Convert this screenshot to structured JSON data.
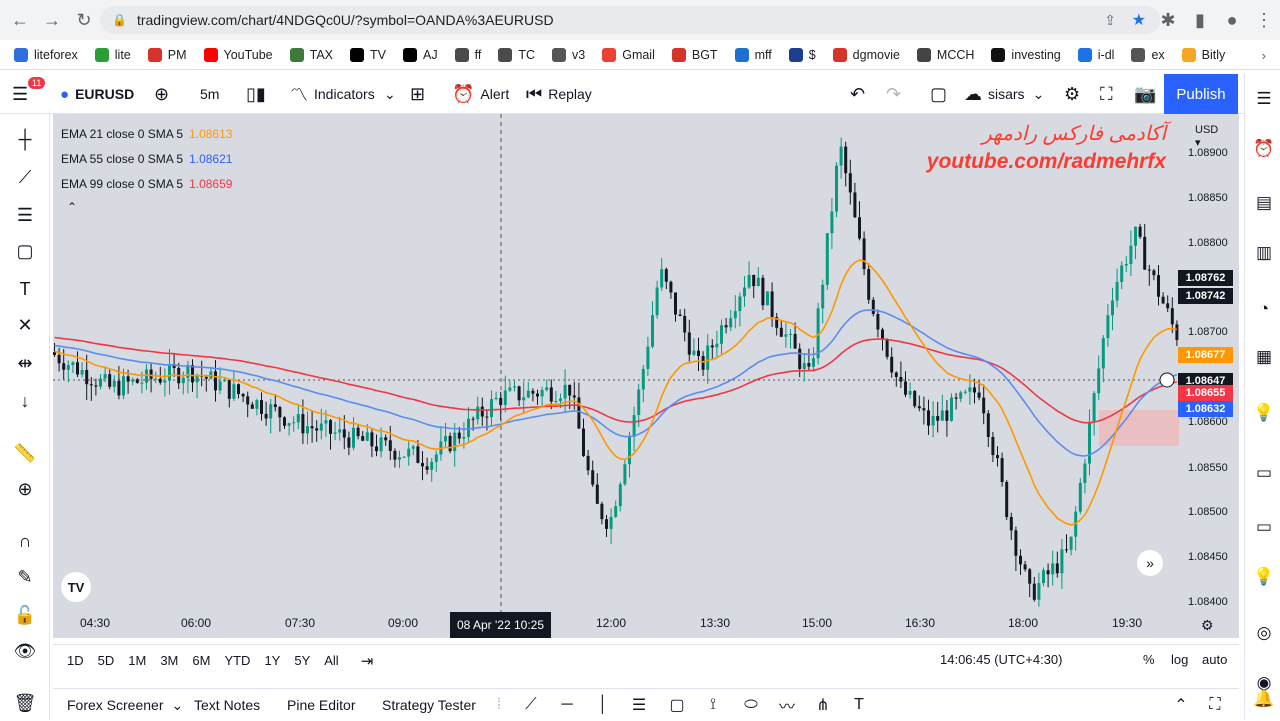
{
  "browser": {
    "url": "tradingview.com/chart/4NDGQc0U/?symbol=OANDA%3AEURUSD",
    "bookmarks": [
      "liteforex",
      "lite",
      "PM",
      "YouTube",
      "TAX",
      "TV",
      "AJ",
      "ff",
      "TC",
      "v3",
      "Gmail",
      "BGT",
      "mff",
      "$",
      "dgmovie",
      "MCCH",
      "investing",
      "i-dl",
      "ex",
      "Bitly"
    ]
  },
  "toolbar": {
    "menu_badge": "11",
    "symbol": "EURUSD",
    "interval": "5m",
    "indicators_label": "Indicators",
    "alert_label": "Alert",
    "replay_label": "Replay",
    "layout_name": "sisars",
    "publish_label": "Publish"
  },
  "legend": [
    {
      "name": "EMA 21 close 0 SMA 5",
      "value": "1.08613",
      "color": "#ff9800"
    },
    {
      "name": "EMA 55 close 0 SMA 5",
      "value": "1.08621",
      "color": "#2962ff"
    },
    {
      "name": "EMA 99 close 0 SMA 5",
      "value": "1.08659",
      "color": "#f23645"
    }
  ],
  "watermark": {
    "line1": "آکادمی فارکس رادمهر",
    "line2": "youtube.com/radmehrfx"
  },
  "price_axis": {
    "currency": "USD",
    "ticks": [
      "1.08900",
      "1.08850",
      "1.08800",
      "1.08700",
      "1.08600",
      "1.08550",
      "1.08500",
      "1.08450",
      "1.08400"
    ],
    "labels": [
      {
        "text": "1.08762",
        "bg": "#131722",
        "fg": "#ffffff"
      },
      {
        "text": "1.08742",
        "bg": "#131722",
        "fg": "#ffffff"
      },
      {
        "text": "1.08677",
        "bg": "#ff9800",
        "fg": "#ffffff"
      },
      {
        "text": "1.08647",
        "bg": "#131722",
        "fg": "#ffffff"
      },
      {
        "text": "1.08655",
        "bg": "#f23645",
        "fg": "#ffffff"
      },
      {
        "text": "1.08632",
        "bg": "#2962ff",
        "fg": "#ffffff"
      }
    ]
  },
  "time_axis": {
    "ticks": [
      "04:30",
      "06:00",
      "07:30",
      "09:00",
      "12:00",
      "13:30",
      "15:00",
      "16:30",
      "18:00",
      "19:30"
    ],
    "cursor": "08 Apr '22   10:25"
  },
  "ranges": [
    "1D",
    "5D",
    "1M",
    "3M",
    "6M",
    "YTD",
    "1Y",
    "5Y",
    "All"
  ],
  "status": {
    "clock": "14:06:45 (UTC+4:30)",
    "percent": "%",
    "log": "log",
    "auto": "auto"
  },
  "bottom_tabs": [
    "Forex Screener",
    "Text Notes",
    "Pine Editor",
    "Strategy Tester"
  ],
  "colors": {
    "up": "#089981",
    "down": "#131722",
    "ema21": "#ff9800",
    "ema55": "#5b8def",
    "ema99": "#f23645"
  }
}
